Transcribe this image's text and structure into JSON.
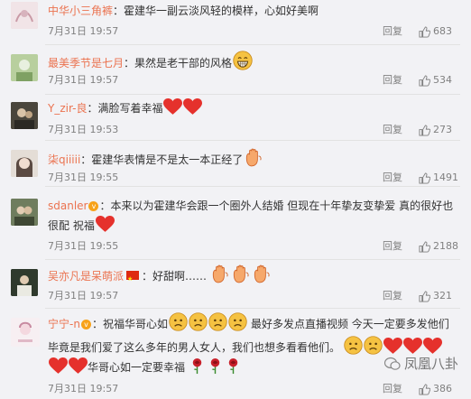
{
  "comments": [
    {
      "name": "中华小三角裤",
      "body": "：霍建华一副云淡风轻的模样，心如好美啊",
      "time": "7月31日 19:57",
      "reply": "回复",
      "likes": "683"
    },
    {
      "name": "最美季节是七月",
      "body": "：果然是老干部的风格",
      "time": "7月31日 19:57",
      "reply": "回复",
      "likes": "534"
    },
    {
      "name": "Y_zir-良",
      "body": "：满脸写着幸福",
      "time": "7月31日 19:53",
      "reply": "回复",
      "likes": "273"
    },
    {
      "name": "柒qiiiii",
      "body": "：霍建华表情是不是太一本正经了",
      "time": "7月31日 19:55",
      "reply": "回复",
      "likes": "1491"
    },
    {
      "name": "sdanler",
      "body": "：本来以为霍建华会跟一个圈外人结婚 但现在十年挚友变挚爱 真的很好也",
      "body2": "很配 祝福",
      "time": "7月31日 19:55",
      "reply": "回复",
      "likes": "2188"
    },
    {
      "name": "吴亦凡是呆萌派",
      "body": "：好甜啊……",
      "time": "7月31日 19:57",
      "reply": "回复",
      "likes": "321"
    },
    {
      "name": "宁宁-n",
      "body": "：祝福华哥心如",
      "body_tail": "最好多发点直播视频 今天一定要多发他们",
      "body2": "毕竟是我们爱了这么多年的男人女人，我们也想多看看他们。",
      "body3": "华哥心如一定要幸福",
      "time": "7月31日 19:57",
      "reply": "回复",
      "likes": "386"
    }
  ],
  "watermark": "凤凰八卦",
  "icons": {
    "like": "thumbs-up-icon",
    "vip": "vip-badge-icon",
    "flag": "china-flag-icon",
    "heart": "heart-icon",
    "rose": "rose-icon",
    "sad": "sad-face-icon",
    "grin": "grin-face-icon",
    "hand": "clap-hands-icon"
  }
}
